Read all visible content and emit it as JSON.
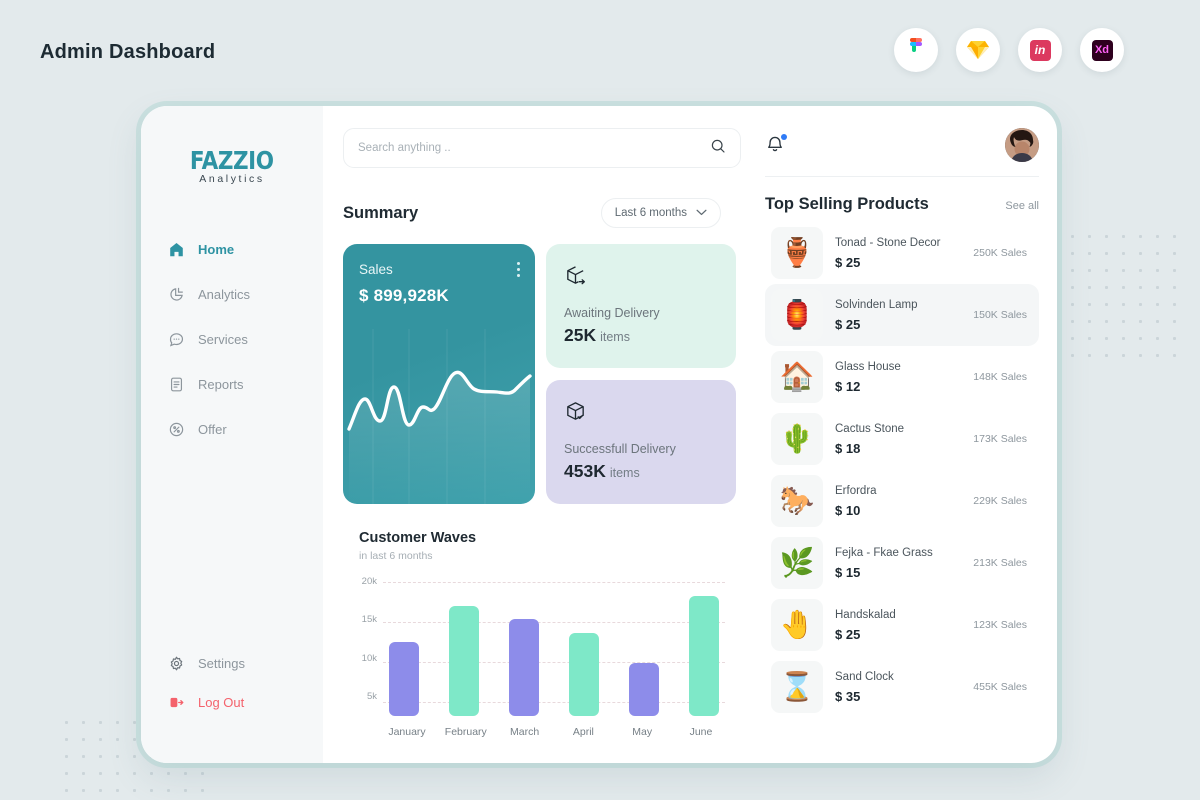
{
  "app": {
    "title": "Admin Dashboard"
  },
  "tool_icons": [
    {
      "name": "figma-icon",
      "label": "Figma"
    },
    {
      "name": "sketch-icon",
      "label": "Sketch"
    },
    {
      "name": "invision-icon",
      "label": "in"
    },
    {
      "name": "adobe-xd-icon",
      "label": "Xd"
    }
  ],
  "sidebar": {
    "logo_main": "FAZZIO",
    "logo_sub": "Analytics",
    "items": [
      {
        "label": "Home",
        "icon": "home-icon",
        "active": true
      },
      {
        "label": "Analytics",
        "icon": "pie-chart-icon",
        "active": false
      },
      {
        "label": "Services",
        "icon": "chat-bubble-icon",
        "active": false
      },
      {
        "label": "Reports",
        "icon": "document-icon",
        "active": false
      },
      {
        "label": "Offer",
        "icon": "discount-tag-icon",
        "active": false
      }
    ],
    "bottom_items": [
      {
        "label": "Settings",
        "icon": "gear-icon"
      },
      {
        "label": "Log Out",
        "icon": "logout-icon"
      }
    ]
  },
  "search": {
    "placeholder": "Search anything ..",
    "value": "",
    "icon": "search-icon"
  },
  "header": {
    "notification_icon": "bell-icon",
    "has_notification": true,
    "avatar": "user-avatar"
  },
  "summary": {
    "title": "Summary",
    "range_label": "Last 6 months",
    "range_icon": "chevron-down-icon",
    "sales_card": {
      "label": "Sales",
      "value": "$ 899,928K",
      "menu_icon": "kebab-menu-icon"
    },
    "awaiting": {
      "icon": "package-arrow-icon",
      "label": "Awaiting Delivery",
      "value": "25K",
      "unit": "items",
      "color": "#dff3ec"
    },
    "successful": {
      "icon": "package-check-icon",
      "label": "Successfull Delivery",
      "value": "453K",
      "unit": "items",
      "color": "#dad8ee"
    }
  },
  "chart_data": [
    {
      "type": "line",
      "title": "Sales",
      "series": [
        {
          "name": "Sales",
          "values": [
            4,
            22,
            9,
            30,
            12,
            6,
            24,
            17,
            20,
            38,
            45,
            34,
            30,
            31,
            28,
            30,
            44
          ]
        }
      ],
      "x": [
        0,
        1,
        2,
        3,
        4,
        5,
        6,
        7,
        8,
        9,
        10,
        11,
        12,
        13,
        14,
        15,
        16
      ],
      "xlabel": "",
      "ylabel": "",
      "grid": true,
      "legend": "none",
      "line_color": "#ffffff",
      "background": "#3494a0"
    },
    {
      "type": "bar",
      "title": "Customer Waves",
      "subtitle": "in last 6 months",
      "categories": [
        "January",
        "February",
        "March",
        "April",
        "May",
        "June"
      ],
      "values": [
        12800,
        17500,
        15800,
        14000,
        10000,
        18800
      ],
      "bar_colors": [
        "#8d8cea",
        "#7ee8c8",
        "#8d8cea",
        "#7ee8c8",
        "#8d8cea",
        "#7ee8c8"
      ],
      "ytick_labels": [
        "20k",
        "15k",
        "10k",
        "5k"
      ],
      "ytick_values": [
        20000,
        15000,
        10000,
        5000
      ],
      "ylim": [
        3000,
        21500
      ],
      "xlabel": "",
      "ylabel": "",
      "grid": true,
      "legend": "none"
    }
  ],
  "top_selling": {
    "title": "Top Selling Products",
    "see_all": "See all",
    "products": [
      {
        "thumb": "🏺",
        "name": "Tonad - Stone Decor",
        "price": "$ 25",
        "sales": "250K Sales",
        "highlight": false
      },
      {
        "thumb": "🏮",
        "name": "Solvinden Lamp",
        "price": "$ 25",
        "sales": "150K Sales",
        "highlight": true
      },
      {
        "thumb": "🏠",
        "name": "Glass House",
        "price": "$ 12",
        "sales": "148K Sales",
        "highlight": false
      },
      {
        "thumb": "🌵",
        "name": "Cactus Stone",
        "price": "$ 18",
        "sales": "173K Sales",
        "highlight": false
      },
      {
        "thumb": "🐎",
        "name": "Erfordra",
        "price": "$ 10",
        "sales": "229K Sales",
        "highlight": false
      },
      {
        "thumb": "🌿",
        "name": "Fejka - Fkae Grass",
        "price": "$ 15",
        "sales": "213K Sales",
        "highlight": false
      },
      {
        "thumb": "🤚",
        "name": "Handskalad",
        "price": "$ 25",
        "sales": "123K Sales",
        "highlight": false
      },
      {
        "thumb": "⌛",
        "name": "Sand Clock",
        "price": "$ 35",
        "sales": "455K Sales",
        "highlight": false
      }
    ]
  },
  "colors": {
    "page_bg": "#e3eaec",
    "teal": "#3494a0",
    "mint": "#dff3ec",
    "lavender": "#dad8ee",
    "bar_purple": "#8d8cea",
    "bar_green": "#7ee8c8",
    "logout_red": "#f4626c"
  }
}
